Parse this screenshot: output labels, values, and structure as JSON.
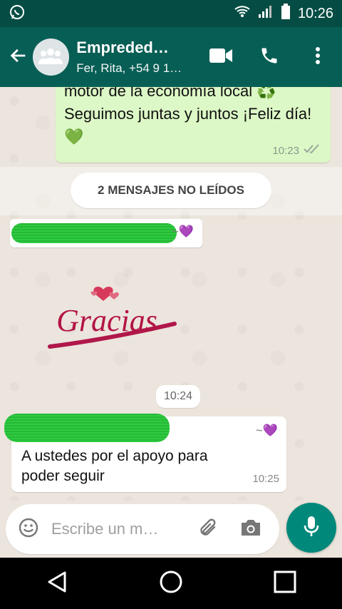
{
  "status_bar": {
    "time": "10:26",
    "app_icon": "whatsapp-icon",
    "wifi_icon": "wifi-icon",
    "signal_icon": "signal-icon",
    "battery_icon": "battery-icon"
  },
  "header": {
    "title": "Empreded…",
    "subtitle": "Fer, Rita, +54 9 1…",
    "back_icon": "arrow-left-icon",
    "avatar_icon": "group-avatar-icon",
    "actions": [
      "video-call-icon",
      "phone-icon",
      "more-vert-icon"
    ]
  },
  "messages": {
    "outgoing": {
      "text": "motor de la economía local ♻️ Seguimos juntas y juntos ¡Feliz día! 💚",
      "time": "10:23",
      "status_icon": "double-check-icon"
    },
    "unread_banner": "2 MENSAJES NO LEÍDOS",
    "incoming1": {
      "sender_suffix": "~💜"
    },
    "sticker": {
      "text": "Gracias"
    },
    "date_pill": "10:24",
    "incoming2": {
      "sender_suffix": "~💜",
      "text": "A ustedes por el apoyo para poder seguir",
      "time": "10:25"
    }
  },
  "composer": {
    "placeholder": "Escribe un m…",
    "emoji_icon": "emoji-icon",
    "attach_icon": "paperclip-icon",
    "camera_icon": "camera-icon",
    "mic_icon": "mic-icon"
  },
  "nav": [
    "back-triangle-icon",
    "home-circle-icon",
    "recents-square-icon"
  ],
  "colors": {
    "header": "#075e54",
    "statusbar": "#054d44",
    "outgoing_bubble": "#dcf8c6",
    "fab": "#00897b"
  }
}
